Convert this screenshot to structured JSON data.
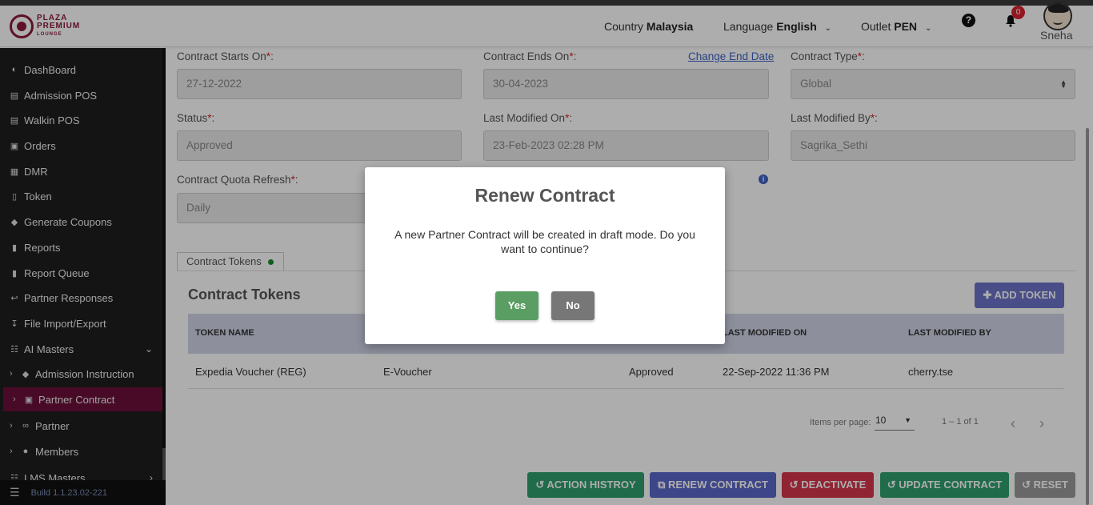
{
  "header": {
    "logo": {
      "line1": "PLAZA",
      "line2": "PREMIUM",
      "line3": "LOUNGE"
    },
    "country_label": "Country",
    "country_value": "Malaysia",
    "language_label": "Language",
    "language_value": "English",
    "outlet_label": "Outlet",
    "outlet_value": "PEN",
    "notification_count": "0",
    "username": "Sneha"
  },
  "sidebar": {
    "items": [
      {
        "label": "DashBoard",
        "icon": "dashboard-icon"
      },
      {
        "label": "Admission POS",
        "icon": "id-card-icon"
      },
      {
        "label": "Walkin POS",
        "icon": "id-card-icon"
      },
      {
        "label": "Orders",
        "icon": "cart-icon"
      },
      {
        "label": "DMR",
        "icon": "calendar-icon"
      },
      {
        "label": "Token",
        "icon": "file-icon"
      },
      {
        "label": "Generate Coupons",
        "icon": "tag-icon"
      },
      {
        "label": "Reports",
        "icon": "book-icon"
      },
      {
        "label": "Report Queue",
        "icon": "book-icon"
      },
      {
        "label": "Partner Responses",
        "icon": "reply-icon"
      },
      {
        "label": "File Import/Export",
        "icon": "download-icon"
      },
      {
        "label": "AI Masters",
        "icon": "sitemap-icon"
      }
    ],
    "sub_items": [
      {
        "label": "Admission Instruction",
        "icon": "tag-icon"
      },
      {
        "label": "Partner Contract",
        "icon": "briefcase-icon"
      },
      {
        "label": "Partner",
        "icon": "handshake-icon"
      },
      {
        "label": "Members",
        "icon": "users-icon"
      }
    ],
    "bottom_item": "LMS Masters",
    "build": "Build 1.1.23.02-221"
  },
  "form": {
    "contract_starts_label": "Contract Starts On",
    "contract_starts_value": "27-12-2022",
    "contract_ends_label": "Contract Ends On",
    "contract_ends_value": "30-04-2023",
    "change_end_date": "Change End Date",
    "contract_type_label": "Contract Type",
    "contract_type_value": "Global",
    "status_label": "Status",
    "status_value": "Approved",
    "last_modified_on_label": "Last Modified On",
    "last_modified_on_value": "23-Feb-2023 02:28 PM",
    "last_modified_by_label": "Last Modified By",
    "last_modified_by_value": "Sagrika_Sethi",
    "quota_refresh_label": "Contract Quota Refresh",
    "quota_refresh_value": "Daily",
    "required_mark": "*",
    "label_suffix": ":"
  },
  "tabs": {
    "contract_tokens": "Contract Tokens"
  },
  "tokens": {
    "title": "Contract Tokens",
    "add_button": "ADD TOKEN",
    "columns": [
      "TOKEN NAME",
      "LAST MODIFIED ON",
      "LAST MODIFIED BY"
    ],
    "rows": [
      {
        "name": "Expedia Voucher (REG)",
        "type": "E-Voucher",
        "status": "Approved",
        "modified_on": "22-Sep-2022 11:36 PM",
        "modified_by": "cherry.tse"
      }
    ],
    "pager": {
      "items_per_page_label": "Items per page:",
      "items_per_page": "10",
      "range": "1 – 1 of 1"
    }
  },
  "actions": {
    "history": "ACTION HISTROY",
    "renew": "RENEW CONTRACT",
    "deactivate": "DEACTIVATE",
    "update": "UPDATE CONTRACT",
    "reset": "RESET"
  },
  "modal": {
    "title": "Renew Contract",
    "message": "A new Partner Contract will be created in draft mode. Do you want to continue?",
    "yes": "Yes",
    "no": "No"
  },
  "colors": {
    "brand": "#8b1a3a",
    "sidebar_active": "#6b0f3a",
    "history_btn": "#2e9e6e",
    "renew_btn": "#5b67c9",
    "deactivate_btn": "#d6364c",
    "update_btn": "#2e9e6e",
    "reset_btn": "#9a9a9a",
    "yes_btn": "#5a9e63",
    "no_btn": "#777777"
  }
}
